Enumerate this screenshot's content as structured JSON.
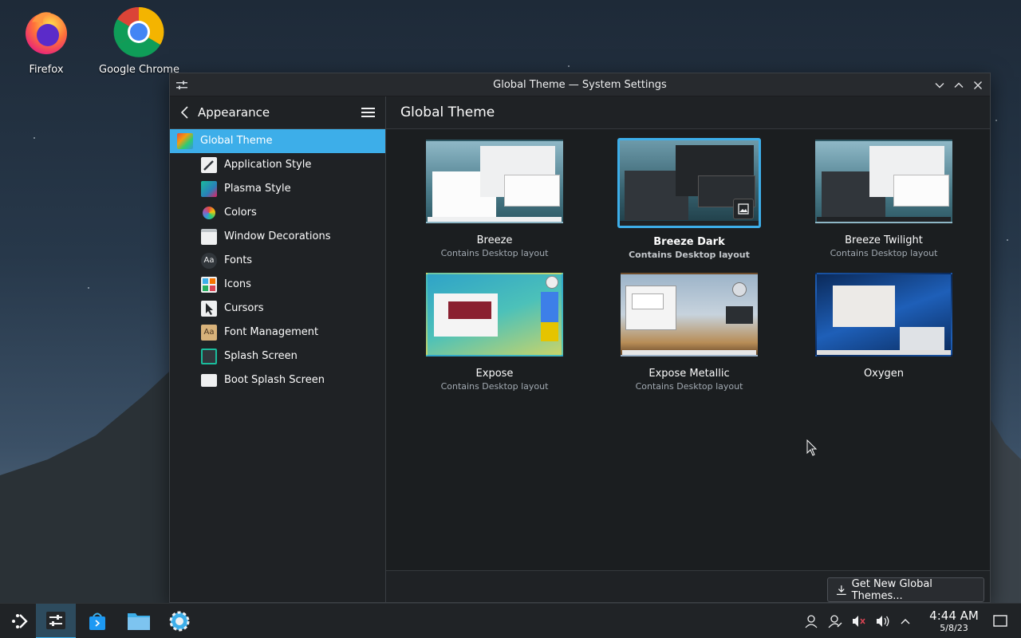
{
  "desktop": {
    "icons": [
      {
        "label": "Firefox"
      },
      {
        "label": "Google Chrome"
      }
    ]
  },
  "window": {
    "title": "Global Theme — System Settings"
  },
  "sidebar": {
    "header": "Appearance",
    "items": [
      {
        "label": "Global Theme",
        "icon": "global-theme-icon"
      },
      {
        "label": "Application Style",
        "icon": "application-style-icon"
      },
      {
        "label": "Plasma Style",
        "icon": "plasma-style-icon"
      },
      {
        "label": "Colors",
        "icon": "colors-icon"
      },
      {
        "label": "Window Decorations",
        "icon": "window-decorations-icon"
      },
      {
        "label": "Fonts",
        "icon": "fonts-icon"
      },
      {
        "label": "Icons",
        "icon": "icons-icon"
      },
      {
        "label": "Cursors",
        "icon": "cursors-icon"
      },
      {
        "label": "Font Management",
        "icon": "font-management-icon"
      },
      {
        "label": "Splash Screen",
        "icon": "splash-screen-icon"
      },
      {
        "label": "Boot Splash Screen",
        "icon": "boot-splash-screen-icon"
      }
    ]
  },
  "main": {
    "title": "Global Theme",
    "themes": [
      {
        "name": "Breeze",
        "desc": "Contains Desktop layout"
      },
      {
        "name": "Breeze Dark",
        "desc": "Contains Desktop layout",
        "selected": true
      },
      {
        "name": "Breeze Twilight",
        "desc": "Contains Desktop layout"
      },
      {
        "name": "Expose",
        "desc": "Contains Desktop layout"
      },
      {
        "name": "Expose Metallic",
        "desc": "Contains Desktop layout"
      },
      {
        "name": "Oxygen",
        "desc": ""
      }
    ],
    "get_new_label": "Get New Global Themes..."
  },
  "taskbar": {
    "time": "4:44 AM",
    "date": "5/8/23"
  },
  "colors": {
    "accent": "#3daee9",
    "window_bg": "#1b1e20",
    "taskbar_bg": "#202326"
  }
}
